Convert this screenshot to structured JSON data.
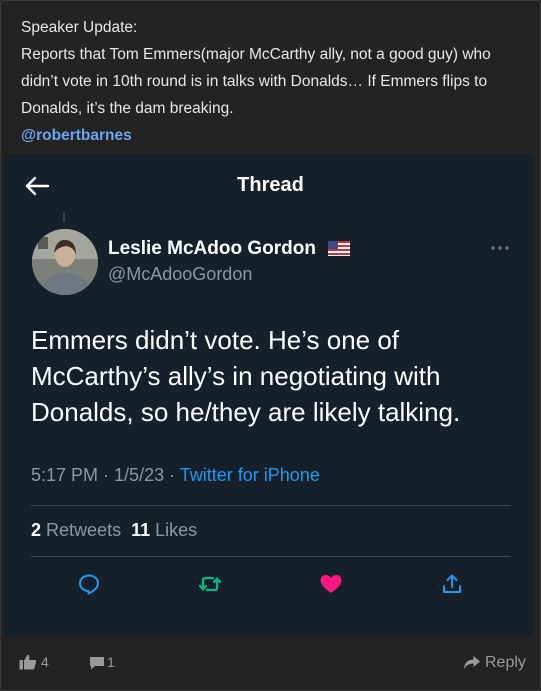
{
  "post": {
    "lines": [
      "Speaker Update:",
      "Reports that Tom Emmers(major McCarthy ally, not a good guy) who",
      "didn’t vote in 10th round is in talks with Donalds… If Emmers flips to",
      "Donalds, it’s the dam breaking."
    ],
    "mention": "@robertbarnes"
  },
  "embed": {
    "header_title": "Thread",
    "author": {
      "name": "Leslie McAdoo Gordon",
      "handle": "@McAdooGordon"
    },
    "tweet_lines": [
      "Emmers didn’t vote. He’s one of",
      "McCarthy’s ally’s in negotiating with",
      "Donalds, so he/they are likely talking."
    ],
    "meta": {
      "time": "5:17 PM",
      "sep1": " · ",
      "date": "1/5/23",
      "sep2": " · ",
      "source": "Twitter for iPhone"
    },
    "stats": {
      "retweets_count": "2",
      "retweets_label": "Retweets",
      "likes_count": "11",
      "likes_label": "Likes"
    },
    "colors": {
      "background": "#15202b",
      "accent": "#1d9bf0",
      "retweet": "#00ba7c",
      "like": "#f91880",
      "divider": "#38444d"
    }
  },
  "footer": {
    "likes": "4",
    "comments": "1",
    "reply_label": "Reply"
  }
}
